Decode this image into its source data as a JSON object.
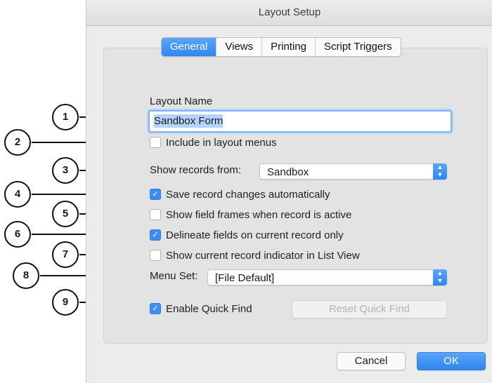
{
  "window": {
    "title": "Layout Setup"
  },
  "tabs": [
    {
      "label": "General",
      "active": true
    },
    {
      "label": "Views",
      "active": false
    },
    {
      "label": "Printing",
      "active": false
    },
    {
      "label": "Script Triggers",
      "active": false
    }
  ],
  "layout_name": {
    "label": "Layout Name",
    "value": "Sandbox Form"
  },
  "checkboxes": [
    {
      "label": "Include in layout menus",
      "checked": false
    },
    {
      "label": "Save record changes automatically",
      "checked": true
    },
    {
      "label": "Show field frames when record is active",
      "checked": false
    },
    {
      "label": "Delineate fields on current record only",
      "checked": true
    },
    {
      "label": "Show current record indicator in List View",
      "checked": false
    },
    {
      "label": "Enable Quick Find",
      "checked": true
    }
  ],
  "show_records": {
    "label": "Show records from:",
    "value": "Sandbox"
  },
  "menu_set": {
    "label": "Menu Set:",
    "value": "[File Default]"
  },
  "buttons": {
    "reset_quick_find": "Reset Quick Find",
    "cancel": "Cancel",
    "ok": "OK"
  },
  "callouts": [
    "1",
    "2",
    "3",
    "4",
    "5",
    "6",
    "7",
    "8",
    "9"
  ],
  "colors": {
    "accent": "#2e86f0",
    "panel": "#e3e3e3",
    "dialog": "#ececec"
  }
}
